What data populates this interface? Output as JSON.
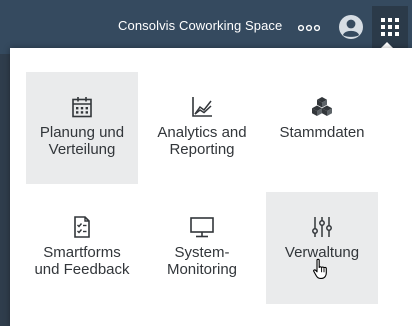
{
  "header": {
    "title": "Consolvis Coworking Space",
    "more_icon": "more-icon",
    "avatar_icon": "user-avatar-icon",
    "app_grid_icon": "app-grid-icon",
    "bar_color": "#354a5f"
  },
  "menu": {
    "tiles": [
      {
        "label": "Planung und\nVerteilung",
        "icon": "calendar-icon",
        "selected": true
      },
      {
        "label": "Analytics and\nReporting",
        "icon": "line-chart-icon",
        "selected": false
      },
      {
        "label": "Stammdaten",
        "icon": "cubes-icon",
        "selected": false
      },
      {
        "label": "Smartforms\nund Feedback",
        "icon": "form-checklist-icon",
        "selected": false
      },
      {
        "label": "System-\nMonitoring",
        "icon": "monitor-icon",
        "selected": false
      },
      {
        "label": "Verwaltung",
        "icon": "sliders-icon",
        "selected": false,
        "hovered": true
      }
    ]
  }
}
